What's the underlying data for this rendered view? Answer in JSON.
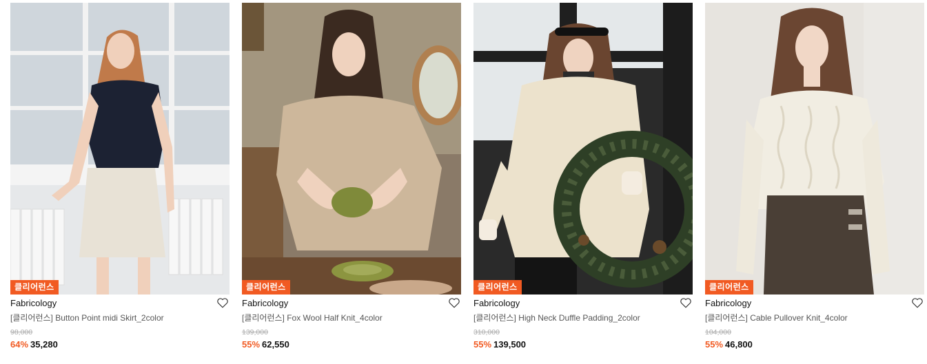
{
  "products": [
    {
      "badge": "클리어런스",
      "brand": "Fabricology",
      "title": "[클리어런스] Button Point midi Skirt_2color",
      "original_price": "98,000",
      "discount": "64%",
      "price": "35,280"
    },
    {
      "badge": "클리어런스",
      "brand": "Fabricology",
      "title": "[클리어런스] Fox Wool Half Knit_4color",
      "original_price": "139,000",
      "discount": "55%",
      "price": "62,550"
    },
    {
      "badge": "클리어런스",
      "brand": "Fabricology",
      "title": "[클리어런스] High Neck Duffle Padding_2color",
      "original_price": "310,000",
      "discount": "55%",
      "price": "139,500"
    },
    {
      "badge": "클리어런스",
      "brand": "Fabricology",
      "title": "[클리어런스] Cable Pullover Knit_4color",
      "original_price": "104,000",
      "discount": "55%",
      "price": "46,800"
    }
  ],
  "colors": {
    "badge_bg": "#f15a22",
    "discount": "#f15a22"
  }
}
